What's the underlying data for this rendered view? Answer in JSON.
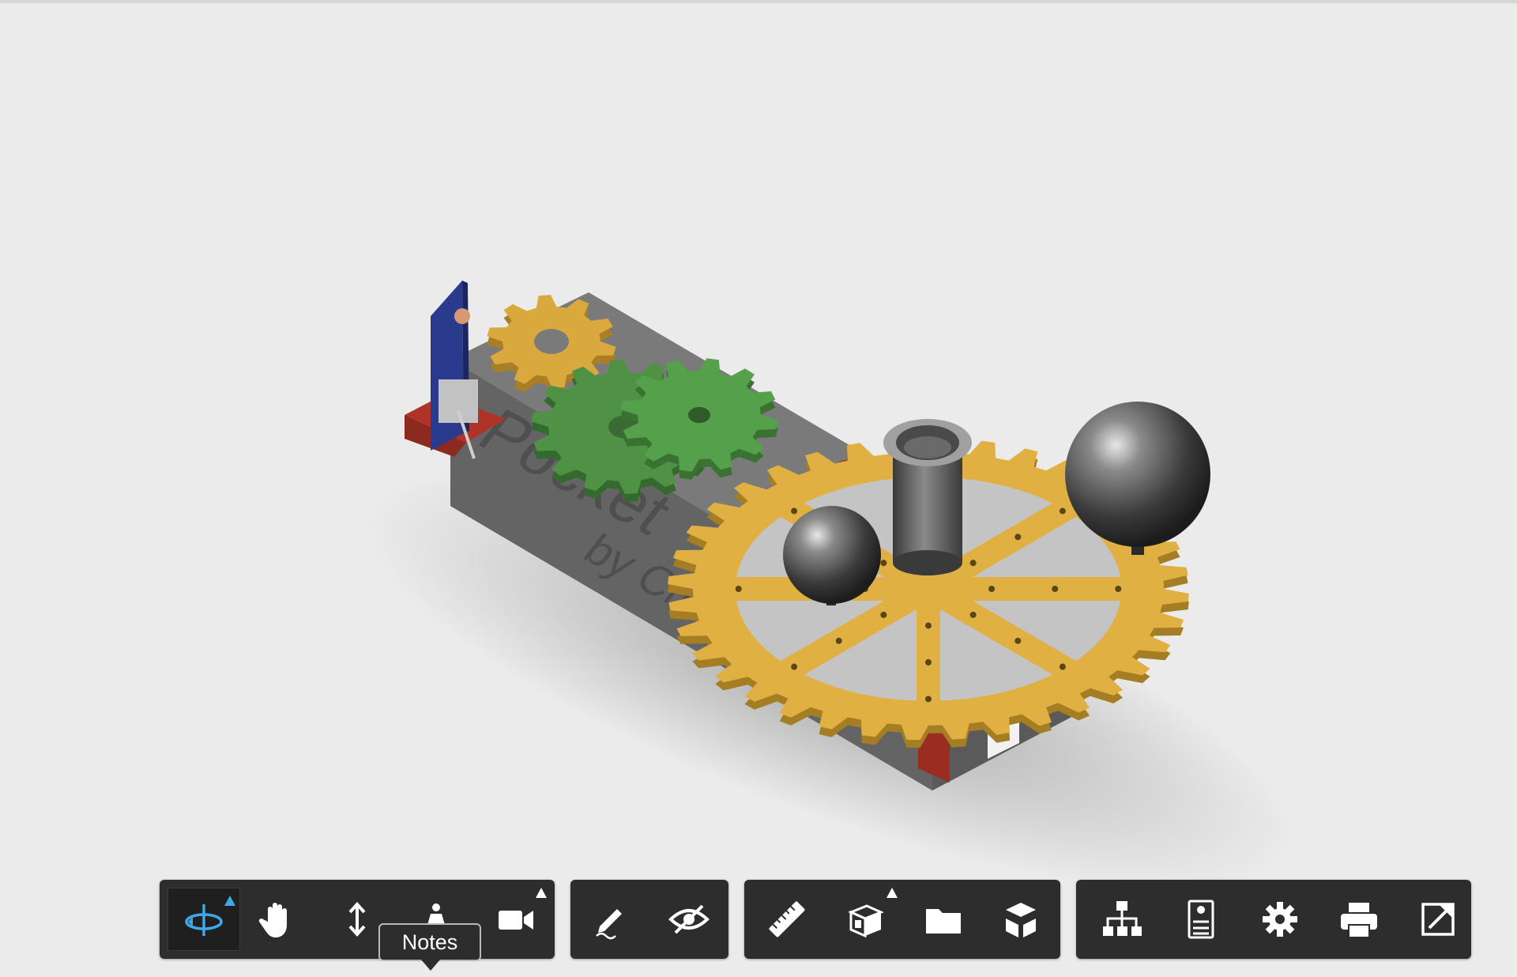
{
  "app": {
    "viewer_background": "#ebebeb",
    "toolbar_background": "#2d2d2d",
    "accent": "#3da9e8"
  },
  "model": {
    "front_text": "Pocket",
    "byline_text": "by CreativeTools"
  },
  "toolbar": {
    "navigation": [
      {
        "name": "orbit-button",
        "icon": "orbit-icon",
        "active": true,
        "flyout": true
      },
      {
        "name": "pan-button",
        "icon": "hand-icon",
        "active": false,
        "flyout": false
      },
      {
        "name": "zoom-button",
        "icon": "zoom-arrows-icon",
        "active": false,
        "flyout": false
      },
      {
        "name": "first-person-button",
        "icon": "person-icon",
        "active": false,
        "flyout": false
      },
      {
        "name": "camera-button",
        "icon": "camera-icon",
        "active": false,
        "flyout": true
      }
    ],
    "review": [
      {
        "name": "markup-button",
        "icon": "pencil-icon"
      },
      {
        "name": "hide-button",
        "icon": "eye-slash-icon"
      }
    ],
    "tools": [
      {
        "name": "measure-button",
        "icon": "ruler-icon"
      },
      {
        "name": "explode-button",
        "icon": "explode-icon",
        "flyout": true
      },
      {
        "name": "model-browser-button",
        "icon": "folder-icon"
      },
      {
        "name": "section-button",
        "icon": "cube-section-icon"
      }
    ],
    "settings": [
      {
        "name": "structure-button",
        "icon": "hierarchy-icon"
      },
      {
        "name": "properties-button",
        "icon": "properties-icon"
      },
      {
        "name": "settings-button",
        "icon": "gear-icon"
      },
      {
        "name": "print-button",
        "icon": "printer-icon"
      },
      {
        "name": "fullscreen-button",
        "icon": "fullscreen-icon"
      }
    ]
  },
  "tooltip": {
    "text": "Notes"
  }
}
